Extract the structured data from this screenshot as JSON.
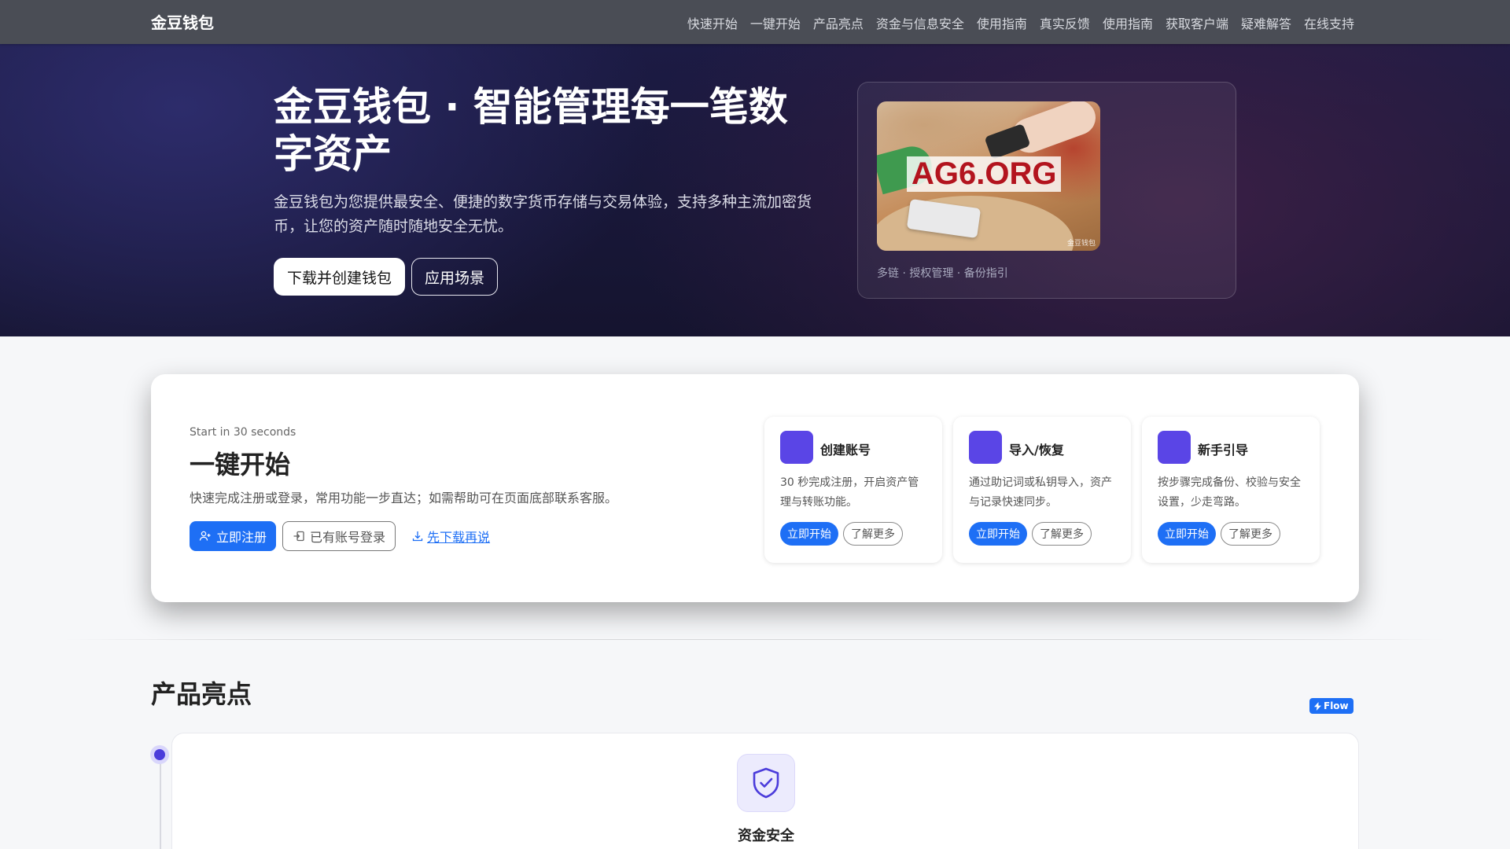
{
  "nav": {
    "brand": "金豆钱包",
    "links": [
      "快速开始",
      "一键开始",
      "产品亮点",
      "资金与信息安全",
      "使用指南",
      "真实反馈",
      "使用指南",
      "获取客户端",
      "疑难解答",
      "在线支持"
    ]
  },
  "hero": {
    "title": "金豆钱包 · 智能管理每一笔数字资产",
    "description": "金豆钱包为您提供最安全、便捷的数字货币存储与交易体验，支持多种主流加密货币，让您的资产随时随地安全无忧。",
    "primary_button": "下载并创建钱包",
    "secondary_button": "应用场景",
    "image_watermark": "AG6.ORG",
    "image_tag": "金豆钱包",
    "image_caption": "多链 · 授权管理 · 备份指引"
  },
  "quick_start": {
    "eyebrow": "Start in 30 seconds",
    "title": "一键开始",
    "description": "快速完成注册或登录，常用功能一步直达；如需帮助可在页面底部联系客服。",
    "register_button": "立即注册",
    "login_button": "已有账号登录",
    "download_link": "先下载再说",
    "cards": [
      {
        "title": "创建账号",
        "description": "30 秒完成注册，开启资产管理与转账功能。",
        "primary": "立即开始",
        "secondary": "了解更多"
      },
      {
        "title": "导入/恢复",
        "description": "通过助记词或私钥导入，资产与记录快速同步。",
        "primary": "立即开始",
        "secondary": "了解更多"
      },
      {
        "title": "新手引导",
        "description": "按步骤完成备份、校验与安全设置，少走弯路。",
        "primary": "立即开始",
        "secondary": "了解更多"
      }
    ]
  },
  "highlights": {
    "title": "产品亮点",
    "badge": "Flow",
    "items": [
      {
        "title": "资金安全",
        "icon": "shield-check-icon"
      }
    ]
  },
  "colors": {
    "nav_bg": "#4a4d55",
    "hero_bg": "#1c1b44",
    "accent": "#1e6ff5",
    "feature_icon": "#5a45e6"
  }
}
